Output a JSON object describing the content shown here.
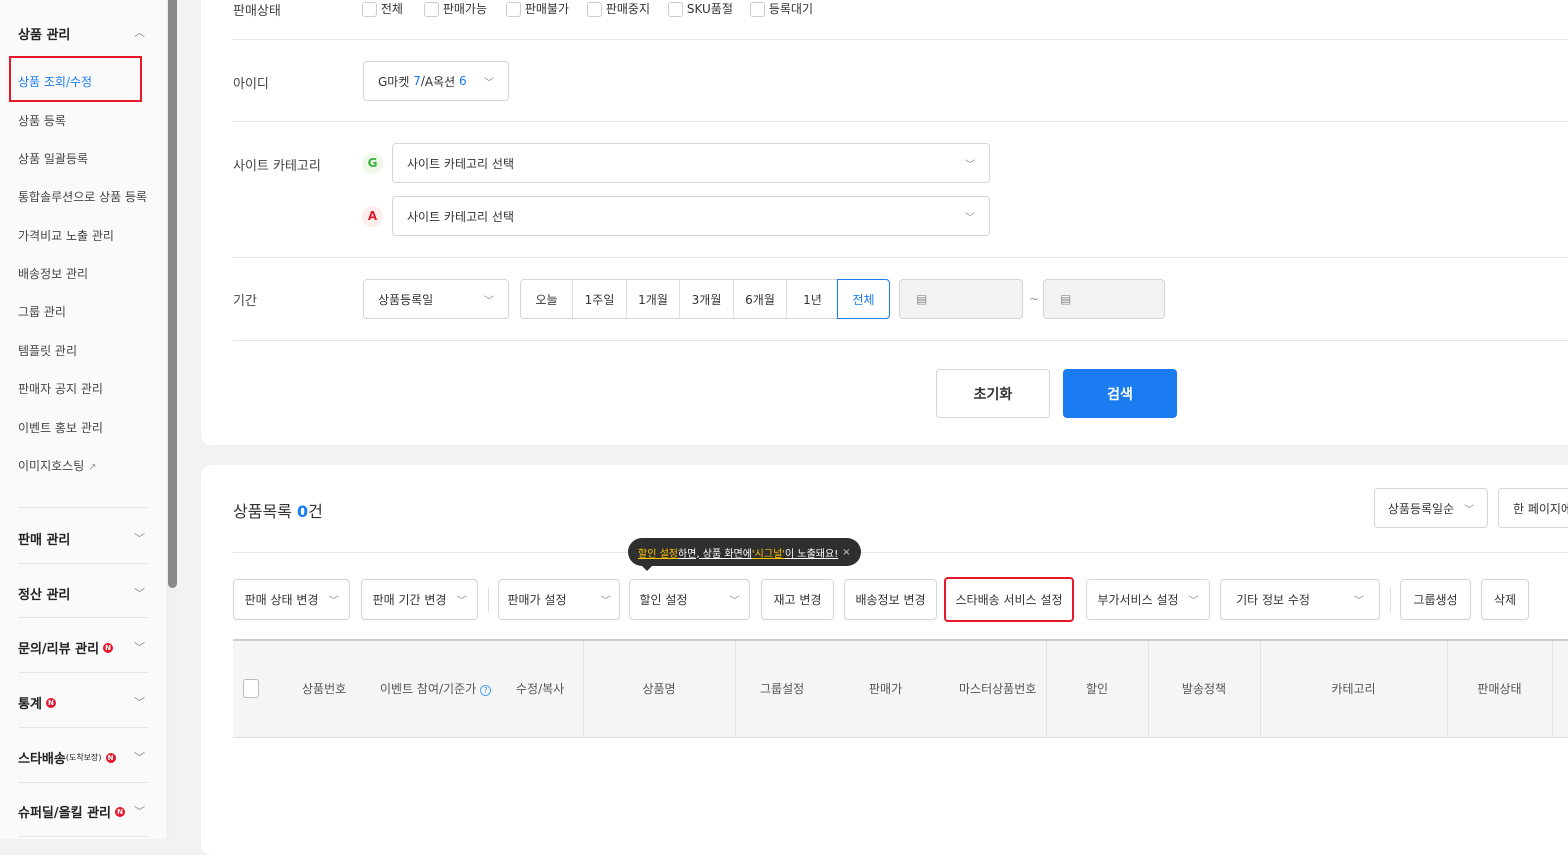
{
  "sidebar": {
    "section_product": "상품 관리",
    "items": [
      "상품 조회/수정",
      "상품 등록",
      "상품 일괄등록",
      "통합솔루션으로 상품 등록",
      "가격비교 노출 관리",
      "배송정보 관리",
      "그룹 관리",
      "템플릿 관리",
      "판매자 공지 관리",
      "이벤트 홍보 관리",
      "이미지호스팅"
    ],
    "sections": [
      {
        "label": "판매 관리",
        "badge": null
      },
      {
        "label": "정산 관리",
        "badge": null
      },
      {
        "label": "문의/리뷰 관리",
        "badge": "N"
      },
      {
        "label": "통계",
        "badge": "N"
      },
      {
        "label": "스타배송",
        "sub": "(도착보장)",
        "badge": "N"
      },
      {
        "label": "슈퍼딜/올킬 관리",
        "badge": "N"
      }
    ]
  },
  "filters": {
    "status_label": "판매상태",
    "status_options": [
      "전체",
      "판매가능",
      "판매불가",
      "판매중지",
      "SKU품절",
      "등록대기"
    ],
    "id_label": "아이디",
    "id_gmarket": "G마켓",
    "id_gmarket_count": "7",
    "id_sep": " / ",
    "id_auction": "A옥션",
    "id_auction_count": "6",
    "category_label": "사이트 카테고리",
    "g_icon": "G",
    "a_icon": "A",
    "category_placeholder": "사이트 카테고리 선택",
    "period_label": "기간",
    "period_type": "상품등록일",
    "period_options": [
      "오늘",
      "1주일",
      "1개월",
      "3개월",
      "6개월",
      "1년",
      "전체"
    ],
    "period_selected": "전체",
    "tilde": "~",
    "reset": "초기화",
    "search": "검색"
  },
  "list": {
    "title": "상품목록",
    "count": "0",
    "count_unit": "건",
    "sort": "상품등록일순",
    "per_page": "한 페이지에",
    "tooltip": {
      "part1": "할인 설정",
      "part2": "하면, 상품 화면에 ",
      "part3": "'시그널'",
      "part4": "이 노출돼요!",
      "close": "×"
    },
    "actions": [
      "판매 상태 변경",
      "판매 기간 변경",
      "판매가 설정",
      "할인 설정",
      "재고 변경",
      "배송정보 변경",
      "스타배송 서비스 설정",
      "부가서비스 설정",
      "기타 정보 수정",
      "그룹생성",
      "삭제"
    ],
    "columns": [
      "상품번호",
      "이벤트 참여/기준가",
      "수정/복사",
      "상품명",
      "그룹설정",
      "판매가",
      "마스터상품번호",
      "할인",
      "발송정책",
      "카테고리",
      "판매상태"
    ]
  },
  "colors": {
    "accent": "#1a7cf0",
    "highlight": "#e8172b"
  }
}
